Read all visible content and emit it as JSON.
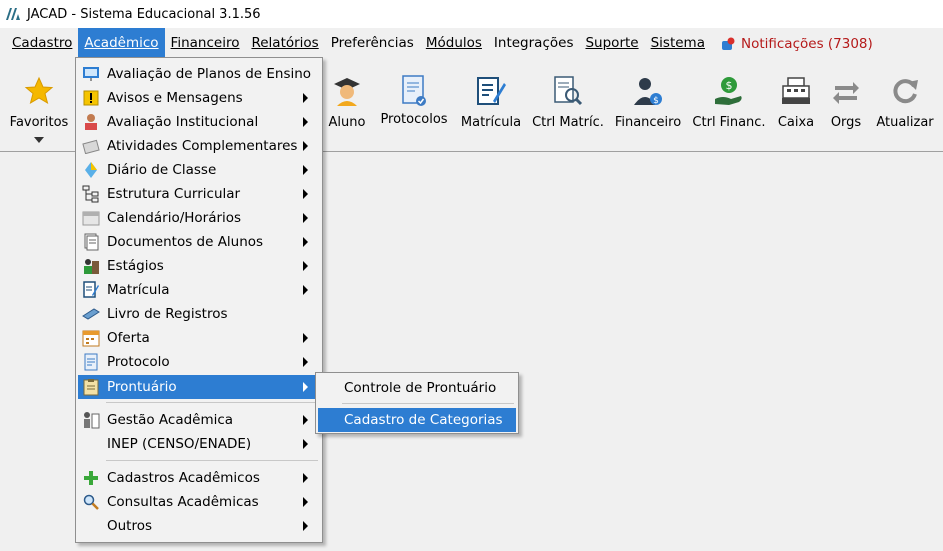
{
  "window": {
    "title": "JACAD - Sistema Educacional 3.1.56"
  },
  "menubar": {
    "items": [
      {
        "label": "Cadastro"
      },
      {
        "label": "Acadêmico"
      },
      {
        "label": "Financeiro"
      },
      {
        "label": "Relatórios"
      },
      {
        "label": "Preferências"
      },
      {
        "label": "Módulos"
      },
      {
        "label": "Integrações"
      },
      {
        "label": "Suporte"
      },
      {
        "label": "Sistema"
      }
    ],
    "notifications": "Notificações (7308)"
  },
  "toolbar": {
    "favoritos": "Favoritos",
    "aluno": "Aluno",
    "protocolos": "Protocolos",
    "matricula": "Matrícula",
    "ctrl_matric": "Ctrl Matríc.",
    "financeiro": "Financeiro",
    "ctrl_financ": "Ctrl Financ.",
    "caixa": "Caixa",
    "orgs": "Orgs",
    "atualizar": "Atualizar"
  },
  "academico_menu": {
    "items": [
      {
        "label": "Avaliação de Planos de Ensino",
        "icon": "presentation-icon"
      },
      {
        "label": "Avisos e Mensagens",
        "icon": "warning-icon"
      },
      {
        "label": "Avaliação Institucional",
        "icon": "evaluation-icon"
      },
      {
        "label": "Atividades Complementares",
        "icon": "activities-icon"
      },
      {
        "label": "Diário de Classe",
        "icon": "diary-icon"
      },
      {
        "label": "Estrutura Curricular",
        "icon": "structure-icon"
      },
      {
        "label": "Calendário/Horários",
        "icon": "calendar-icon"
      },
      {
        "label": "Documentos de Alunos",
        "icon": "documents-icon"
      },
      {
        "label": "Estágios",
        "icon": "internship-icon"
      },
      {
        "label": "Matrícula",
        "icon": "enrollment-icon"
      },
      {
        "label": "Livro de Registros",
        "icon": "book-icon"
      },
      {
        "label": "Oferta",
        "icon": "offer-icon"
      },
      {
        "label": "Protocolo",
        "icon": "protocol-icon"
      },
      {
        "label": "Prontuário",
        "icon": "clipboard-icon"
      },
      {
        "label": "Gestão Acadêmica",
        "icon": "management-icon"
      },
      {
        "label": "INEP (CENSO/ENADE)",
        "icon": ""
      },
      {
        "label": "Cadastros Acadêmicos",
        "icon": "plus-icon"
      },
      {
        "label": "Consultas Acadêmicas",
        "icon": "magnifier-icon"
      },
      {
        "label": "Outros",
        "icon": ""
      }
    ]
  },
  "prontuario_submenu": {
    "items": [
      {
        "label": "Controle de Prontuário"
      },
      {
        "label": "Cadastro de Categorias"
      }
    ]
  },
  "colors": {
    "highlight": "#2d7dd2",
    "notification": "#b51a1a"
  }
}
